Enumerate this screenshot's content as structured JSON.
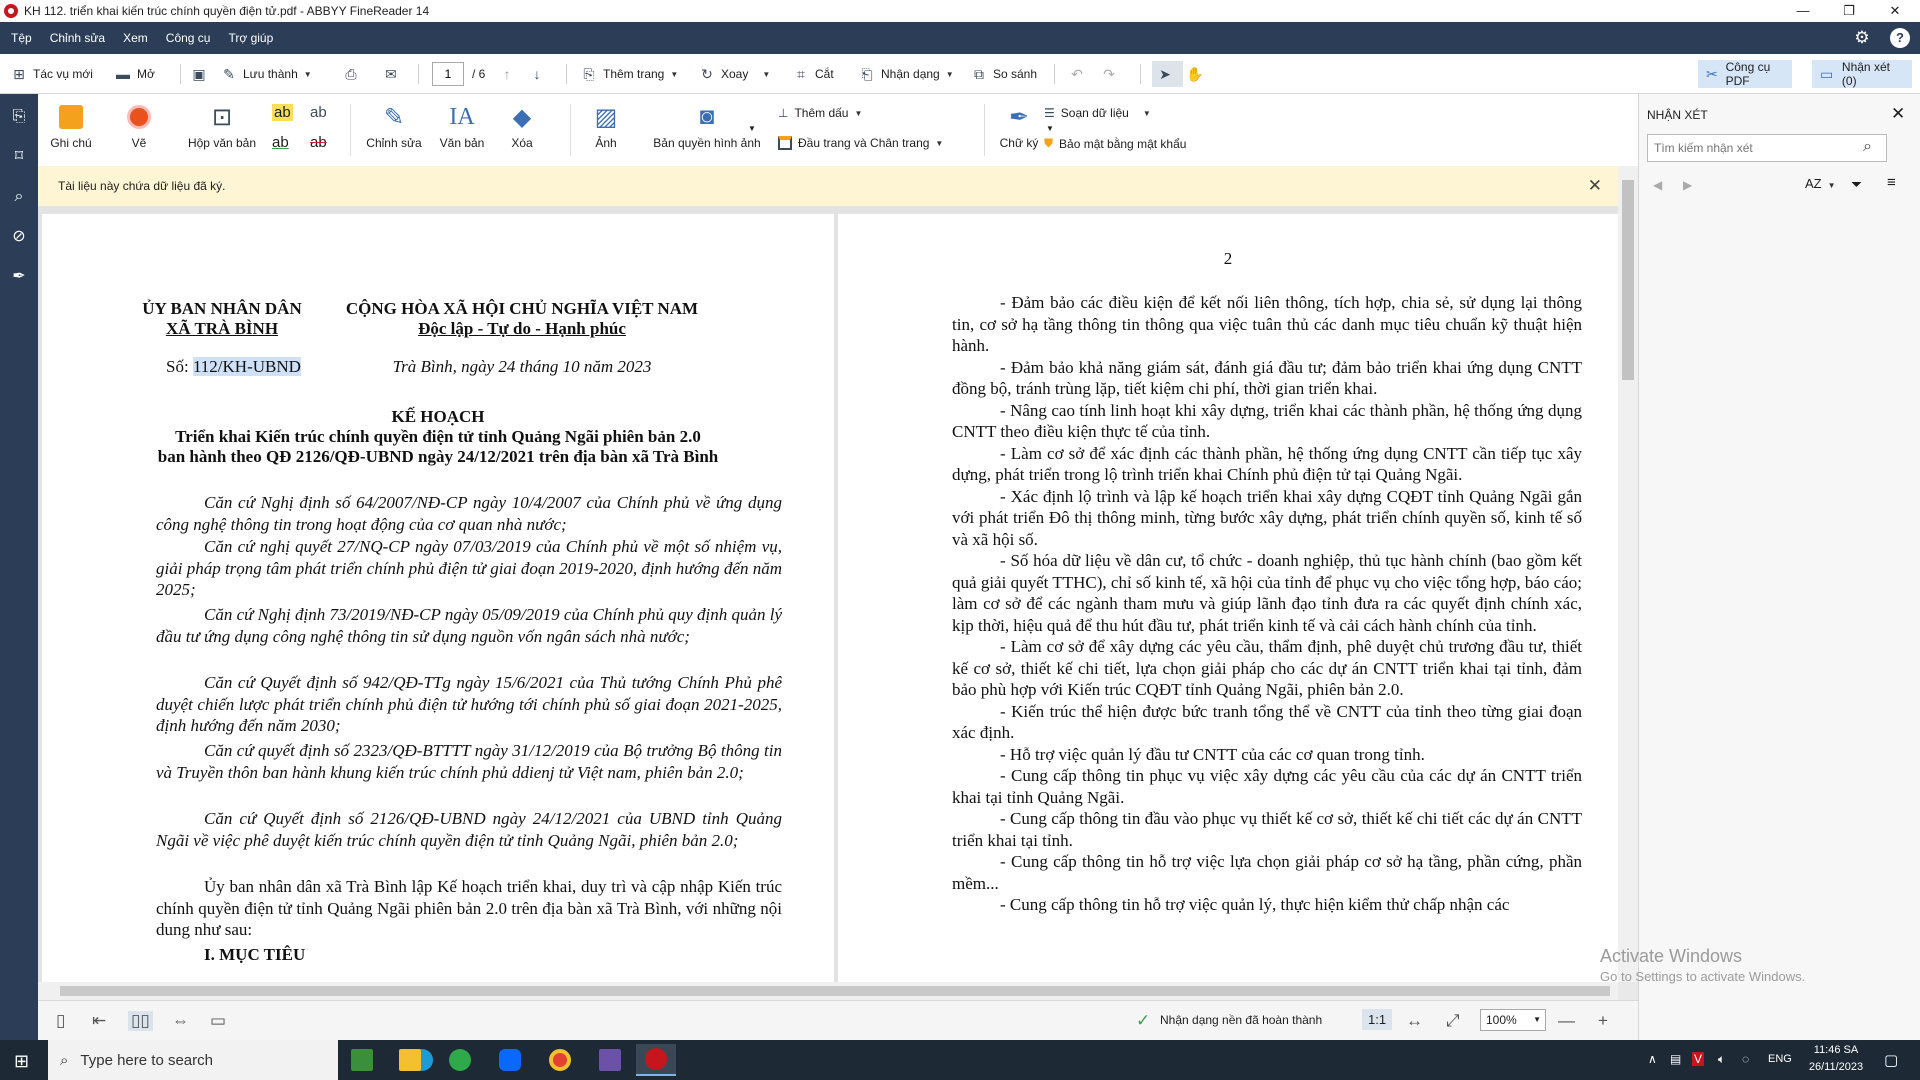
{
  "window": {
    "title": "KH 112. triển khai kiến trúc chính quyền điện tử.pdf - ABBYY FineReader 14",
    "minimize": "—",
    "restore": "❐",
    "close": "✕"
  },
  "menu": [
    "Tệp",
    "Chỉnh sửa",
    "Xem",
    "Công cụ",
    "Trợ giúp"
  ],
  "toolbar": {
    "new_task": "Tác vụ mới",
    "open": "Mở",
    "save_as": "Lưu thành",
    "page_current": "1",
    "page_total": "/ 6",
    "add_page": "Thêm trang",
    "rotate": "Xoay",
    "crop": "Cắt",
    "recognize": "Nhận dạng",
    "compare": "So sánh",
    "pdf_tools": "Công cụ PDF",
    "comments": "Nhận xét (0)"
  },
  "ribbon": {
    "note": "Ghi chú",
    "draw": "Vẽ",
    "textbox": "Hộp văn bản",
    "edit": "Chỉnh sửa",
    "text": "Văn bản",
    "erase": "Xóa",
    "image": "Ảnh",
    "watermark": "Bản quyền hình ảnh",
    "add_marker": "Thêm dấu",
    "header_footer": "Đầu trang và Chân trang",
    "signature": "Chữ ký",
    "edit_data": "Soạn dữ liệu",
    "password": "Bảo mật bằng mật khẩu",
    "ab": "ab"
  },
  "notice": {
    "text": "Tài liệu này chứa dữ liệu đã ký.",
    "close": "✕"
  },
  "page1": {
    "org1": "ỦY BAN NHÂN DÂN",
    "org2": "XÃ TRÀ BÌNH",
    "nation1": "CỘNG HÒA XÃ HỘI CHỦ NGHĨA VIỆT NAM",
    "nation2": "Độc lập - Tự do - Hạnh phúc",
    "so_label": "Số:",
    "so_value": "112/KH-UBND",
    "date": "Trà Bình, ngày 24 tháng 10 năm 2023",
    "doc_type": "KẾ HOẠCH",
    "doc_title1": "Triển khai Kiến trúc chính quyền điện tử tỉnh Quảng Ngãi phiên bản 2.0",
    "doc_title2": "ban hành theo QĐ 2126/QĐ-UBND ngày 24/12/2021 trên địa bàn xã Trà Bình",
    "paras": [
      "Căn cứ Nghị định số 64/2007/NĐ-CP ngày 10/4/2007 của Chính phủ về ứng dụng công nghệ thông tin trong hoạt động của cơ quan nhà nước;",
      "Căn cứ nghị quyết 27/NQ-CP ngày 07/03/2019 của Chính phủ về một số nhiệm vụ, giải pháp trọng tâm phát triển chính phủ điện tử giai đoạn 2019-2020, định hướng đến năm 2025;",
      "Căn cứ Nghị định 73/2019/NĐ-CP ngày 05/09/2019 của Chính phủ quy định quản lý đầu tư ứng dụng công nghệ thông tin sử dụng nguồn vốn ngân sách nhà nước;",
      "Căn cứ Quyết định số 942/QĐ-TTg ngày 15/6/2021 của Thủ tướng Chính Phủ phê duyệt chiến lược phát triển chính phủ điện tử hướng tới chính phủ số giai đoạn 2021-2025, định hướng đến năm 2030;",
      "Căn cứ quyết định số 2323/QĐ-BTTTT ngày 31/12/2019 của Bộ trưởng Bộ thông tin và Truyền thôn ban hành khung kiến trúc chính phủ ddienj tử Việt nam, phiên bản 2.0;",
      "Căn cứ Quyết định số 2126/QĐ-UBND ngày 24/12/2021 của UBND tỉnh Quảng Ngãi về việc phê duyệt kiến trúc chính quyền điện tử tỉnh Quảng Ngãi, phiên bản 2.0;"
    ],
    "intro": "Ủy ban nhân dân xã Trà Bình lập Kế hoạch triển khai, duy trì và cập nhập Kiến trúc chính quyền điện tử tỉnh Quảng Ngãi phiên bản 2.0 trên địa bàn xã Trà Bình, với những nội dung như sau:",
    "section": "I. MỤC TIÊU"
  },
  "page2": {
    "page_number": "2",
    "paras": [
      "- Đảm bảo các điều kiện để kết nối liên thông, tích hợp, chia sẻ, sử dụng lại thông tin, cơ sở hạ tầng thông tin thông qua việc tuân thủ các danh mục tiêu chuẩn kỹ thuật hiện hành.",
      "- Đảm bảo khả năng giám sát, đánh giá đầu tư; đảm bảo triển khai ứng dụng CNTT đồng bộ, tránh trùng lặp, tiết kiệm chi phí, thời gian triển khai.",
      "- Nâng cao tính linh hoạt khi xây dựng, triển khai các thành phần, hệ thống ứng dụng CNTT theo điều kiện thực tế của tỉnh.",
      "- Làm cơ sở để xác định các thành phần, hệ thống ứng dụng CNTT cần tiếp tục xây dựng, phát triển trong lộ trình triển khai Chính phủ điện tử tại Quảng Ngãi.",
      "- Xác định lộ trình và lập kế hoạch triển khai xây dựng CQĐT tỉnh Quảng Ngãi gắn với phát triển Đô thị thông minh, từng bước xây dựng, phát triển chính quyền số, kinh tế số và xã hội số.",
      "- Số hóa dữ liệu về dân cư, tổ chức - doanh nghiệp, thủ tục hành chính (bao gồm kết quả giải quyết TTHC), chỉ số kinh tế, xã hội của tỉnh để phục vụ cho việc tổng hợp, báo cáo; làm cơ sở để các ngành tham mưu và giúp lãnh đạo tỉnh đưa ra các quyết định chính xác, kịp thời, hiệu quả để thu hút đầu tư, phát triển kinh tế và cải cách hành chính của tỉnh.",
      "- Làm cơ sở để xây dựng các yêu cầu, thẩm định, phê duyệt chủ trương đầu tư, thiết kế cơ sở, thiết kế chi tiết, lựa chọn giải pháp cho các dự án CNTT triển khai tại tỉnh, đảm bảo phù hợp với Kiến trúc CQĐT tỉnh Quảng Ngãi, phiên bản 2.0.",
      "- Kiến trúc thể hiện được bức tranh tổng thể về CNTT của tỉnh theo từng giai đoạn xác định.",
      "- Hỗ trợ việc quản lý đầu tư CNTT của các cơ quan trong tỉnh.",
      "- Cung cấp thông tin phục vụ việc xây dựng các yêu cầu của các dự án CNTT triển khai tại tỉnh Quảng Ngãi.",
      "- Cung cấp thông tin đầu vào phục vụ thiết kế cơ sở, thiết kế chi tiết các dự án CNTT triển khai tại tỉnh.",
      "- Cung cấp thông tin hỗ trợ việc lựa chọn giải pháp cơ sở hạ tầng, phần cứng, phần mềm...",
      "- Cung cấp thông tin hỗ trợ việc quản lý, thực hiện kiểm thử chấp nhận các"
    ]
  },
  "status": {
    "recognition": "Nhận dạng nền đã hoàn thành",
    "ratio": "1:1",
    "zoom": "100%"
  },
  "right_panel": {
    "title": "NHẬN XÉT",
    "search_placeholder": "Tìm kiếm nhận xét",
    "sort": "AZ"
  },
  "activation": {
    "line1": "Activate Windows",
    "line2": "Go to Settings to activate Windows."
  },
  "taskbar": {
    "search_text": "Type here to search",
    "lang": "ENG",
    "time": "11:46 SA",
    "date": "26/11/2023"
  },
  "colors": {
    "navy": "#2b3d57",
    "notice_bg": "#fdf5d3",
    "highlight": "#cfe1f7",
    "accent_red": "#c4161c"
  }
}
